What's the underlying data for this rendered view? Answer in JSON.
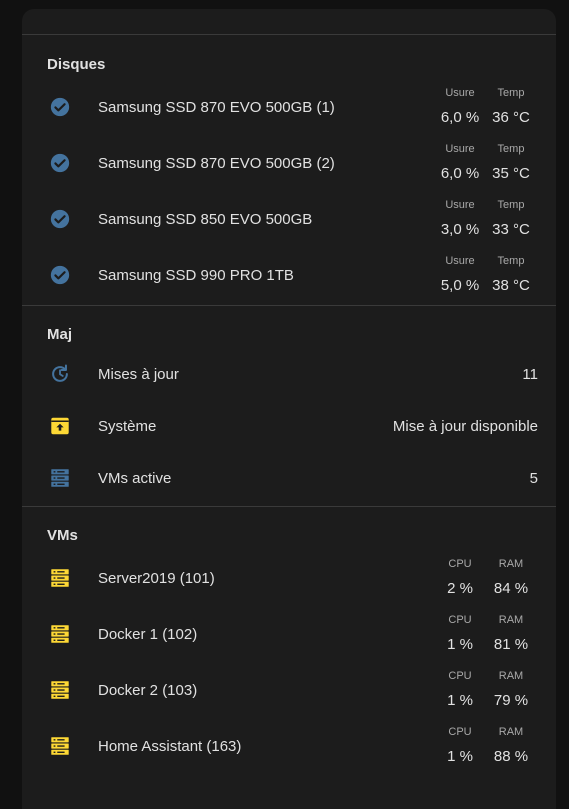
{
  "colors": {
    "background": "#111111",
    "card": "#1c1c1c",
    "divider": "#3a3a3a",
    "text": "#e1e1e1",
    "muted": "#a9a9a9",
    "blue_icon": "#44739e",
    "yellow_icon": "#fdd835"
  },
  "disques": {
    "title": "Disques",
    "head_usure": "Usure",
    "head_temp": "Temp",
    "items": [
      {
        "name": "Samsung SSD 870 EVO 500GB (1)",
        "usure": "6,0 %",
        "temp": "36 °C",
        "icon": "check-circle-icon"
      },
      {
        "name": "Samsung SSD 870 EVO 500GB (2)",
        "usure": "6,0 %",
        "temp": "35 °C",
        "icon": "check-circle-icon"
      },
      {
        "name": "Samsung SSD 850 EVO 500GB",
        "usure": "3,0 %",
        "temp": "33 °C",
        "icon": "check-circle-icon"
      },
      {
        "name": "Samsung SSD 990 PRO 1TB",
        "usure": "5,0 %",
        "temp": "38 °C",
        "icon": "check-circle-icon"
      }
    ]
  },
  "maj": {
    "title": "Maj",
    "items": [
      {
        "name": "Mises à jour",
        "value": "11",
        "icon": "update-icon"
      },
      {
        "name": "Système",
        "value": "Mise à jour disponible",
        "icon": "package-up-icon"
      },
      {
        "name": "VMs active",
        "value": "5",
        "icon": "server-icon"
      }
    ]
  },
  "vms": {
    "title": "VMs",
    "head_cpu": "CPU",
    "head_ram": "RAM",
    "items": [
      {
        "name": "Server2019 (101)",
        "cpu": "2 %",
        "ram": "84 %",
        "icon": "server-icon"
      },
      {
        "name": "Docker 1 (102)",
        "cpu": "1 %",
        "ram": "81 %",
        "icon": "server-icon"
      },
      {
        "name": "Docker 2 (103)",
        "cpu": "1 %",
        "ram": "79 %",
        "icon": "server-icon"
      },
      {
        "name": "Home Assistant (163)",
        "cpu": "1 %",
        "ram": "88 %",
        "icon": "server-icon"
      }
    ]
  }
}
